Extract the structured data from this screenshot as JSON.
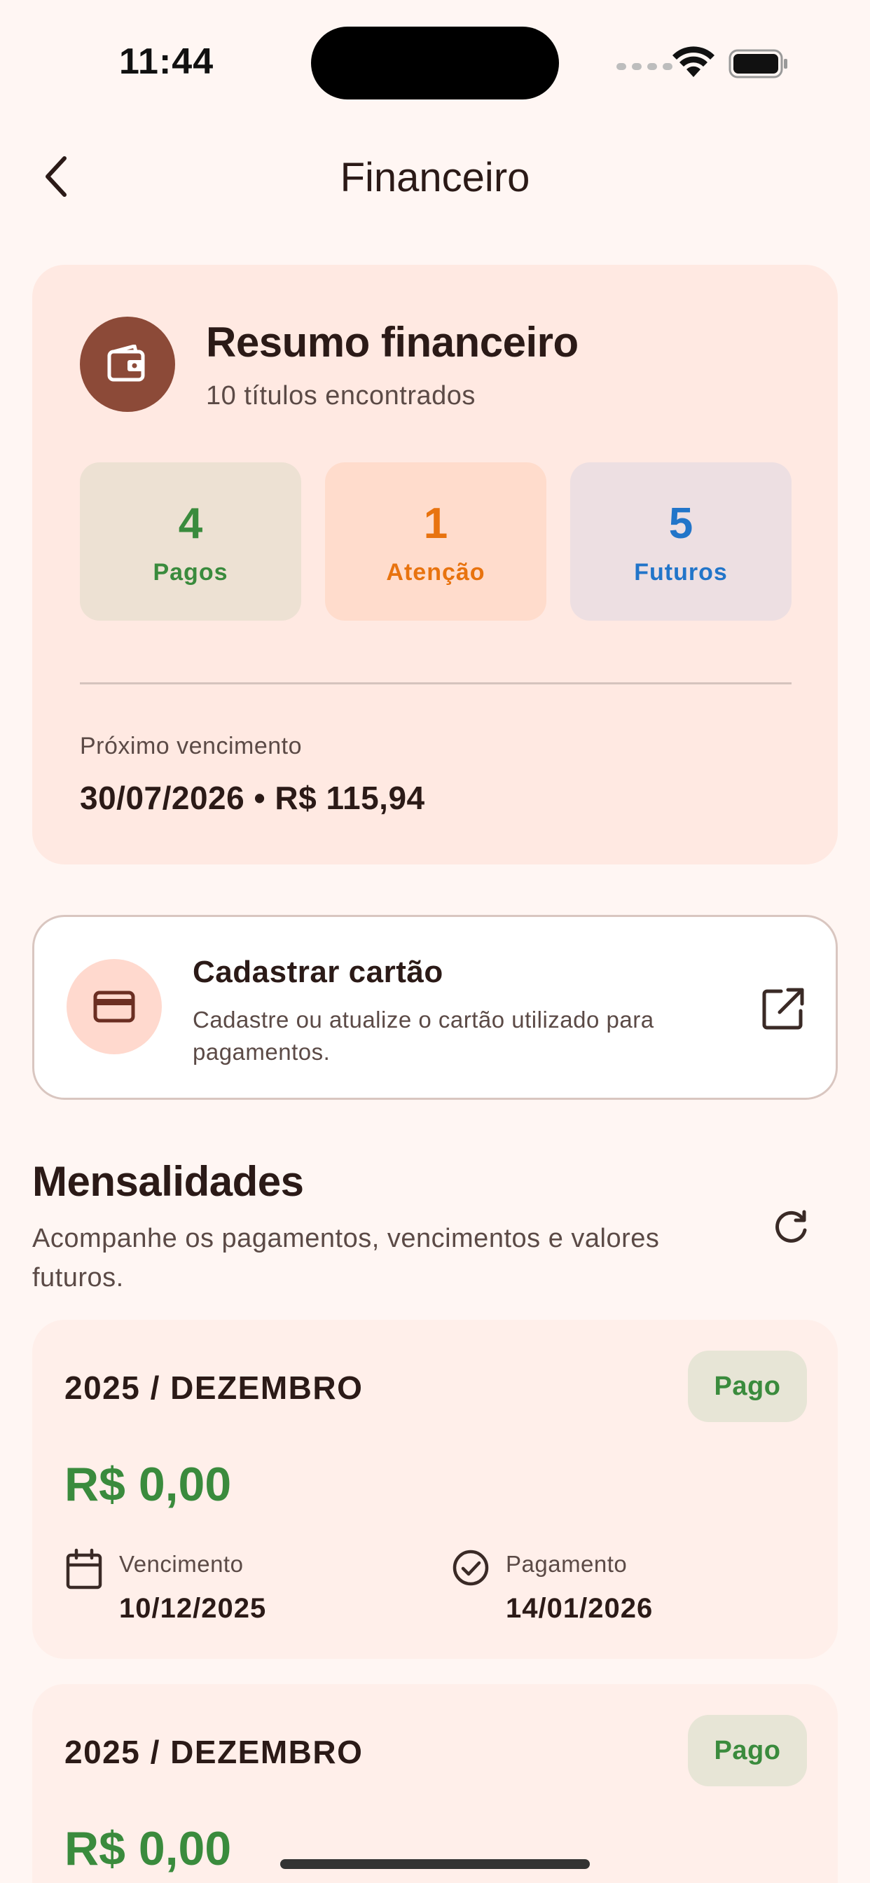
{
  "status_bar": {
    "time": "11:44"
  },
  "header": {
    "title": "Financeiro"
  },
  "summary": {
    "title": "Resumo financeiro",
    "subtitle": "10 títulos encontrados",
    "stats": [
      {
        "value": "4",
        "label": "Pagos",
        "color": "#3A8B3D"
      },
      {
        "value": "1",
        "label": "Atenção",
        "color": "#E8730F"
      },
      {
        "value": "5",
        "label": "Futuros",
        "color": "#2275C9"
      }
    ],
    "next_due_label": "Próximo vencimento",
    "next_due_value": "30/07/2026 • R$ 115,94"
  },
  "card_register": {
    "title": "Cadastrar cartão",
    "description": "Cadastre ou atualize o cartão utilizado para pagamentos."
  },
  "section": {
    "title": "Mensalidades",
    "description": "Acompanhe os pagamentos, vencimentos e valores futuros."
  },
  "payments": [
    {
      "period": "2025 / DEZEMBRO",
      "status": "Pago",
      "amount": "R$ 0,00",
      "due_label": "Vencimento",
      "due_date": "10/12/2025",
      "paid_label": "Pagamento",
      "paid_date": "14/01/2026"
    },
    {
      "period": "2025 / DEZEMBRO",
      "status": "Pago",
      "amount": "R$ 0,00"
    }
  ],
  "colors": {
    "background": "#FFF6F3",
    "accent": "#8C4A38",
    "paid": "#3A8B3D",
    "attention": "#E8730F",
    "future": "#2275C9"
  },
  "icons": [
    "back-chevron-icon",
    "wallet-icon",
    "credit-card-icon",
    "external-link-icon",
    "refresh-icon",
    "calendar-icon",
    "check-circle-icon",
    "wifi-icon",
    "battery-icon"
  ]
}
